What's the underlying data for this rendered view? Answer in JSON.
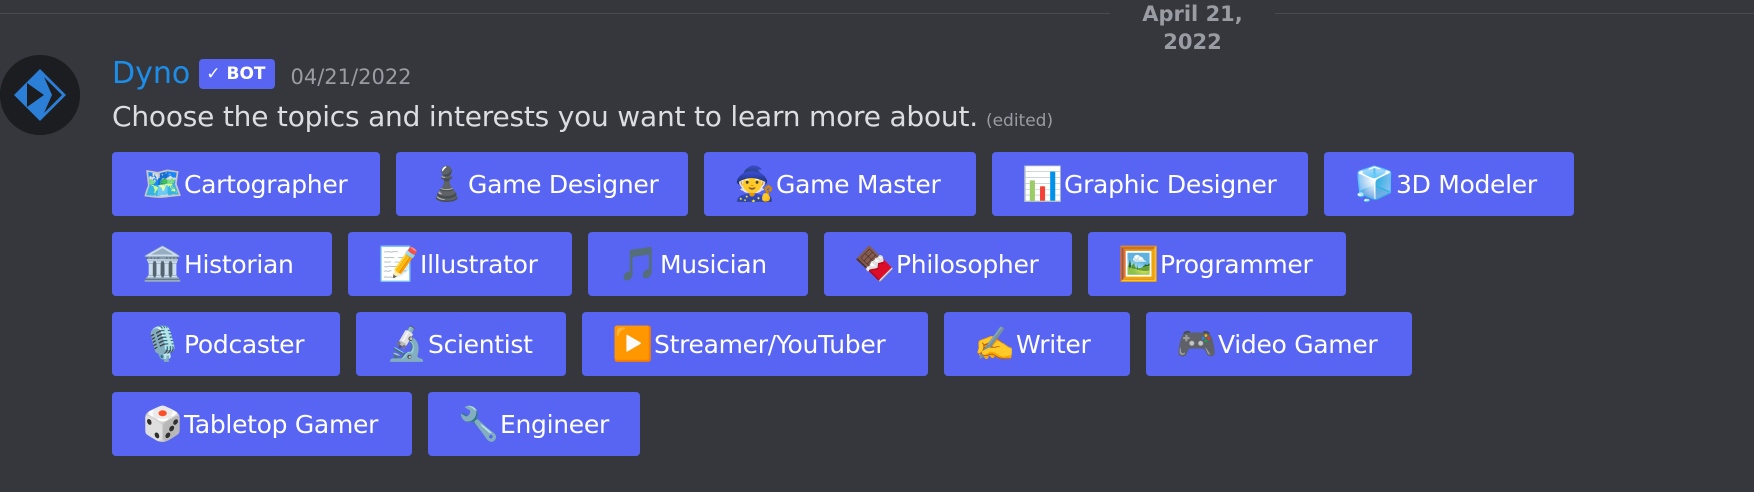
{
  "divider": {
    "date": "April 21, 2022"
  },
  "message": {
    "author": "Dyno",
    "badge": "BOT",
    "badge_icon": "check-icon",
    "timestamp": "04/21/2022",
    "text": "Choose the topics and interests you want to learn more about.",
    "edited": "(edited)"
  },
  "colors": {
    "background": "#36373d",
    "button": "#5865f2",
    "username": "#1c8eea",
    "muted_text": "#9a9ca3",
    "body_text": "#dcdde1"
  },
  "buttons": [
    {
      "label": "Cartographer",
      "icon": "world-map-icon",
      "glyph": "🗺️"
    },
    {
      "label": "Game Designer",
      "icon": "chess-pawn-icon",
      "glyph": "♟️"
    },
    {
      "label": "Game Master",
      "icon": "mage-icon",
      "glyph": "🧙"
    },
    {
      "label": "Graphic Designer",
      "icon": "bar-chart-icon",
      "glyph": "📊"
    },
    {
      "label": "3D Modeler",
      "icon": "ice-cube-icon",
      "glyph": "🧊"
    },
    {
      "label": "Historian",
      "icon": "classical-building-icon",
      "glyph": "🏛️"
    },
    {
      "label": "Illustrator",
      "icon": "memo-icon",
      "glyph": "📝"
    },
    {
      "label": "Musician",
      "icon": "musical-notes-icon",
      "glyph": "🎵"
    },
    {
      "label": "Philosopher",
      "icon": "chocolate-bar-icon",
      "glyph": "🍫"
    },
    {
      "label": "Programmer",
      "icon": "hackers-poster-icon",
      "glyph": "🖼️"
    },
    {
      "label": "Podcaster",
      "icon": "microphone-icon",
      "glyph": "🎙️"
    },
    {
      "label": "Scientist",
      "icon": "microscope-icon",
      "glyph": "🔬"
    },
    {
      "label": "Streamer/YouTuber",
      "icon": "play-button-icon",
      "glyph": "▶️"
    },
    {
      "label": "Writer",
      "icon": "writing-hand-icon",
      "glyph": "✍️"
    },
    {
      "label": "Video Gamer",
      "icon": "game-controller-icon",
      "glyph": "🎮"
    },
    {
      "label": "Tabletop Gamer",
      "icon": "game-die-icon",
      "glyph": "🎲"
    },
    {
      "label": "Engineer",
      "icon": "wrench-icon",
      "glyph": "🔧"
    }
  ]
}
